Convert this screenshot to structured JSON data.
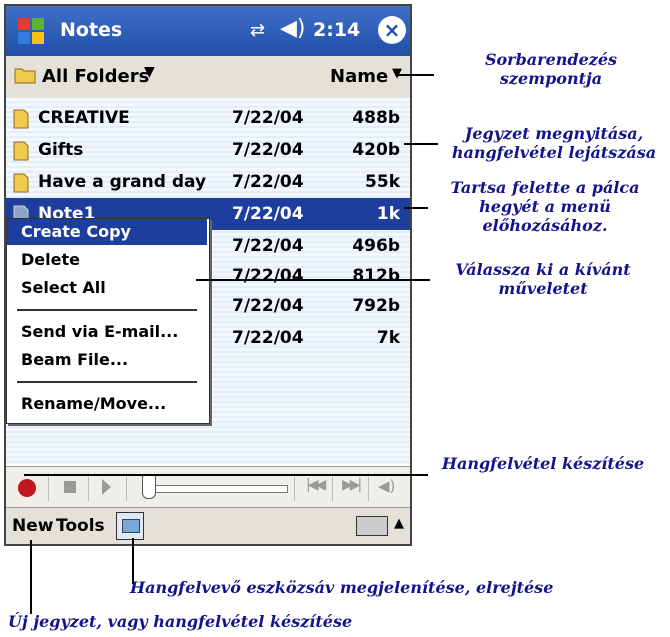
{
  "window": {
    "title": "Notes",
    "time": "2:14",
    "close_label": "×",
    "connectivity_icon": "connectivity-icon",
    "volume_icon": "speaker-icon"
  },
  "folderbar": {
    "folder": "All Folders",
    "sort": "Name"
  },
  "files": [
    {
      "name": "CREATIVE",
      "date": "7/22/04",
      "size": "488b"
    },
    {
      "name": "Gifts",
      "date": "7/22/04",
      "size": "420b"
    },
    {
      "name": "Have a grand day",
      "date": "7/22/04",
      "size": "55k"
    },
    {
      "name": "Note1",
      "date": "7/22/04",
      "size": "1k"
    },
    {
      "name": "",
      "date": "7/22/04",
      "size": "496b"
    },
    {
      "name": "",
      "date": "7/22/04",
      "size": "812b"
    },
    {
      "name": "",
      "date": "7/22/04",
      "size": "792b"
    },
    {
      "name": "",
      "date": "7/22/04",
      "size": "7k"
    }
  ],
  "context_menu": {
    "items": [
      "Create Copy",
      "Delete",
      "Select All",
      "Send via E-mail...",
      "Beam File...",
      "Rename/Move..."
    ]
  },
  "commandbar": {
    "new": "New",
    "tools": "Tools"
  },
  "annotations": {
    "sort": "Sorbarendezés szempontja",
    "open": "Jegyzet megnyitása, hangfelvétel lejátszása",
    "hold": "Tartsa felette a pálca hegyét a menü előhozásához.",
    "choose": "Válassza ki a kívánt műveletet",
    "record": "Hangfelvétel készítése",
    "toolbar": "Hangfelvevő eszközsáv megjelenítése, elrejtése",
    "new": "Új jegyzet, vagy hangfelvétel készítése"
  }
}
